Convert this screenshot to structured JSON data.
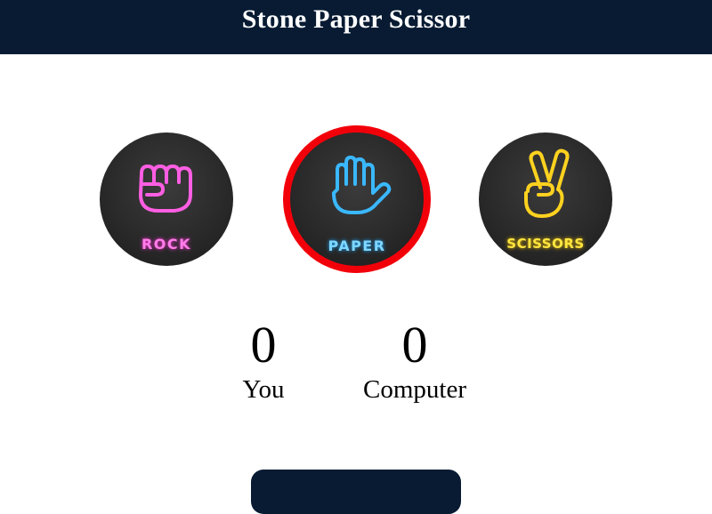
{
  "header": {
    "title": "Stone Paper Scissor"
  },
  "choices": [
    {
      "id": "rock",
      "label": "ROCK",
      "icon": "rock-fist-icon",
      "color": "#ff7de9",
      "selected": false
    },
    {
      "id": "paper",
      "label": "PAPER",
      "icon": "paper-hand-icon",
      "color": "#7fd6ff",
      "selected": true
    },
    {
      "id": "scissors",
      "label": "SCISSORS",
      "icon": "scissors-hand-icon",
      "color": "#ffe640",
      "selected": false
    }
  ],
  "scores": {
    "user": {
      "value": "0",
      "label": "You"
    },
    "computer": {
      "value": "0",
      "label": "Computer"
    }
  },
  "colors": {
    "header_bg": "#081b33",
    "selected_border": "#f2000a",
    "choice_bg": "#2a2a2a"
  }
}
